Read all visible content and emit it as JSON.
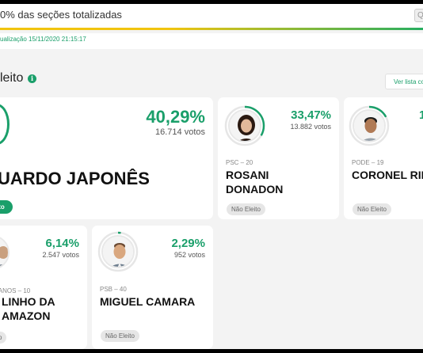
{
  "header": {
    "status_text": "0% das seções totalizadas",
    "last_update": "ualização 15/11/2020 21:15:17"
  },
  "section": {
    "title": "leito",
    "info_icon": "info-icon",
    "ver_lista": "Ver lista co"
  },
  "colors": {
    "accent": "#1a9f6a",
    "progress_start": "#f1c40f",
    "progress_end": "#27ae60"
  },
  "candidates": [
    {
      "name_line1": "UARDO JAPONÊS",
      "name_line2": "",
      "percent": "40,29%",
      "votes": "16.714 votos",
      "party": "",
      "status": "ito",
      "percent_value": 40.29
    },
    {
      "name_line1": "ROSANI",
      "name_line2": "DONADON",
      "percent": "33,47%",
      "votes": "13.882 votos",
      "party": "PSC – 20",
      "status": "Não Eleito",
      "percent_value": 33.47
    },
    {
      "name_line1": "CORONEL RIL",
      "name_line2": "",
      "percent": "1",
      "votes": "",
      "party": "PODE – 19",
      "status": "Não Eleito",
      "percent_value": 17
    },
    {
      "name_line1": "LINHO DA",
      "name_line2": "AMAZON",
      "percent": "6,14%",
      "votes": "2.547 votos",
      "party": "CANOS – 10",
      "status": "o",
      "percent_value": 6.14
    },
    {
      "name_line1": "MIGUEL CAMARA",
      "name_line2": "",
      "percent": "2,29%",
      "votes": "952 votos",
      "party": "PSB – 40",
      "status": "Não Eleito",
      "percent_value": 2.29
    }
  ]
}
